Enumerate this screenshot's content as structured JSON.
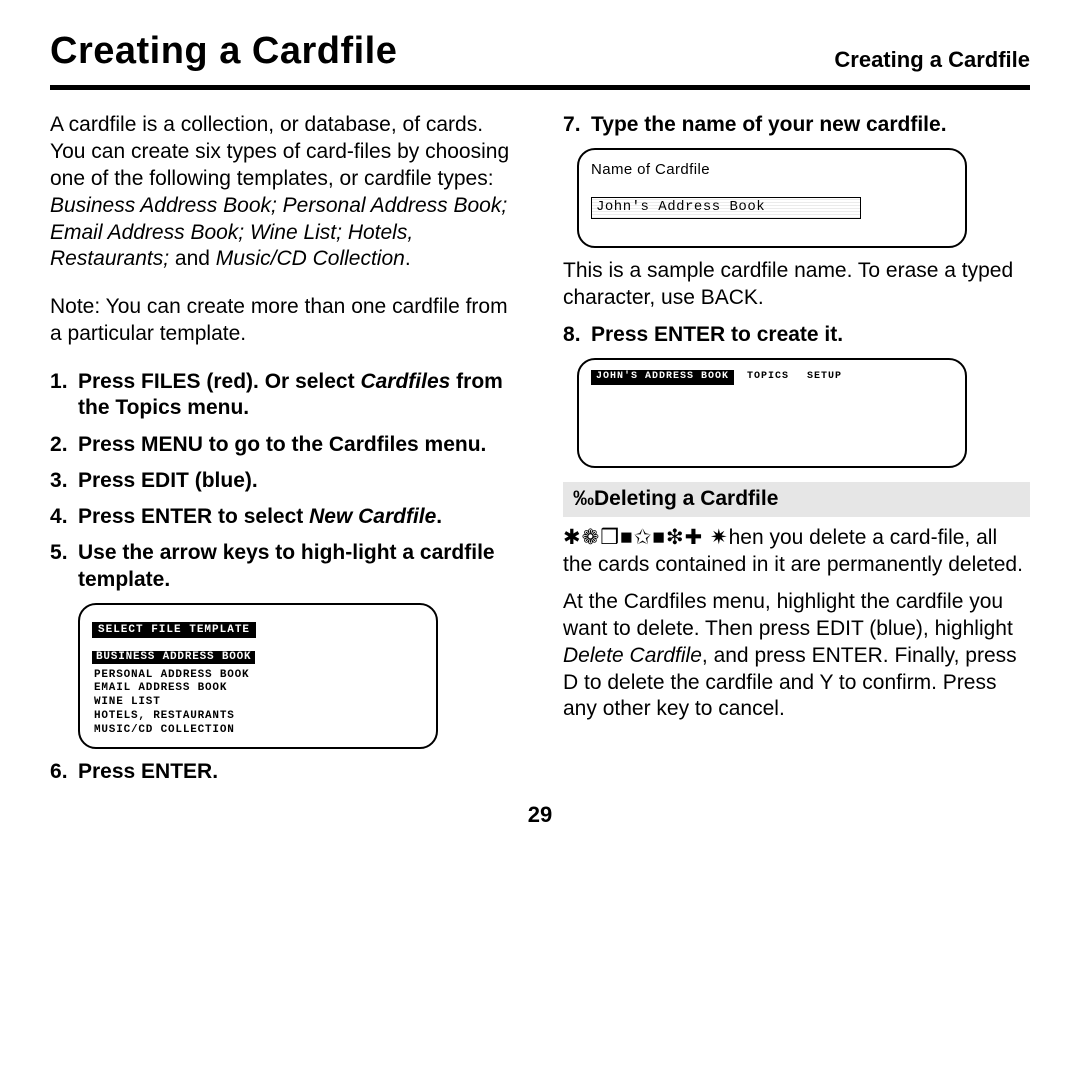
{
  "header": {
    "title_main": "Creating a Cardfile",
    "title_run": "Creating a Cardfile"
  },
  "left": {
    "intro_pre": "A cardfile is a collection, or database, of cards. You can create six types of card-files by choosing one of the following templates, or cardfile types: ",
    "templates_italic": "Business Address Book; Personal Address Book; Email Address Book; Wine List; Hotels, Restaurants; ",
    "and_word": "and ",
    "templates_last": "Music/CD Collection",
    "period": ".",
    "note": "Note: You can create more than one cardfile from a particular template.",
    "step1_a": "Press FILES (red). Or select ",
    "step1_i": "Cardfiles",
    "step1_b": " from the Topics menu.",
    "step2": "Press MENU to go to the Cardfiles menu.",
    "step3": "Press EDIT (blue).",
    "step4_a": "Press ENTER to select ",
    "step4_i": "New Cardfile",
    "step4_b": ".",
    "step5": "Use the arrow keys to high-light a cardfile template.",
    "lcd1": {
      "title": "SELECT FILE TEMPLATE",
      "sel": "BUSINESS ADDRESS BOOK",
      "rows": [
        "PERSONAL ADDRESS BOOK",
        "EMAIL ADDRESS BOOK",
        "WINE LIST",
        "HOTELS, RESTAURANTS",
        "MUSIC/CD COLLECTION"
      ]
    },
    "step6": "Press ENTER."
  },
  "right": {
    "step7": "Type the name of your new cardfile.",
    "lcd2": {
      "label": "Name of Cardfile",
      "value": "John's Address Book"
    },
    "sample_text": "This is a sample cardfile name. To erase a typed character, use BACK.",
    "step8": "Press ENTER to create it.",
    "lcd3": {
      "tab_active": "JOHN'S ADDRESS BOOK",
      "tab2": "TOPICS",
      "tab3": "SETUP"
    },
    "sub_prefix": "‰",
    "sub_heading": "Deleting a Cardfile",
    "warn_ding": "✱❁❒■✩■❇✚ ✷",
    "warn_text": "hen you delete a card-file, all the cards contained in it are permanently deleted.",
    "del_text_a": "At the Cardfiles menu, highlight the cardfile you want to delete. Then press EDIT (blue), highlight ",
    "del_text_i": "Delete Cardfile",
    "del_text_b": ", and press ENTER. Finally, press D to delete the cardfile and Y to confirm. Press any other key to cancel."
  },
  "page_number": "29"
}
